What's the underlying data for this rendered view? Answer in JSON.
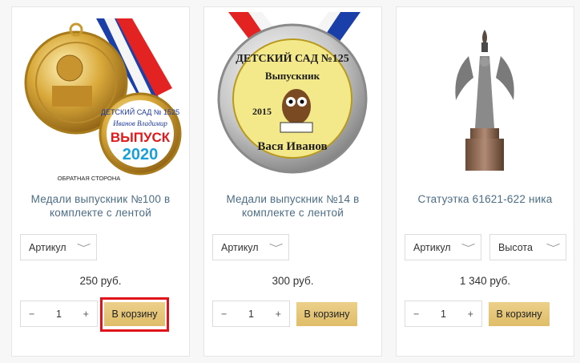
{
  "products": [
    {
      "title": "Медали выпускник №100 в комплекте с лентой",
      "image_caption": "ОБРАТНАЯ СТОРОНА",
      "selects": [
        {
          "label": "Артикул"
        }
      ],
      "price": "250 руб.",
      "qty": "1",
      "minus": "−",
      "plus": "+",
      "cart_label": "В корзину",
      "highlighted": true
    },
    {
      "title": "Медали выпускник №14 в комплекте с лентой",
      "selects": [
        {
          "label": "Артикул"
        }
      ],
      "price": "300 руб.",
      "qty": "1",
      "minus": "−",
      "plus": "+",
      "cart_label": "В корзину"
    },
    {
      "title": "Статуэтка 61621-622 ника",
      "selects": [
        {
          "label": "Артикул"
        },
        {
          "label": "Высота"
        }
      ],
      "price": "1 340 руб.",
      "qty": "1",
      "minus": "−",
      "plus": "+",
      "cart_label": "В корзину"
    }
  ],
  "icons": {
    "chevron": "chevron-down-icon"
  },
  "colors": {
    "accent": "#e7c97d",
    "title": "#4b6d84",
    "highlight": "#e0121a"
  }
}
